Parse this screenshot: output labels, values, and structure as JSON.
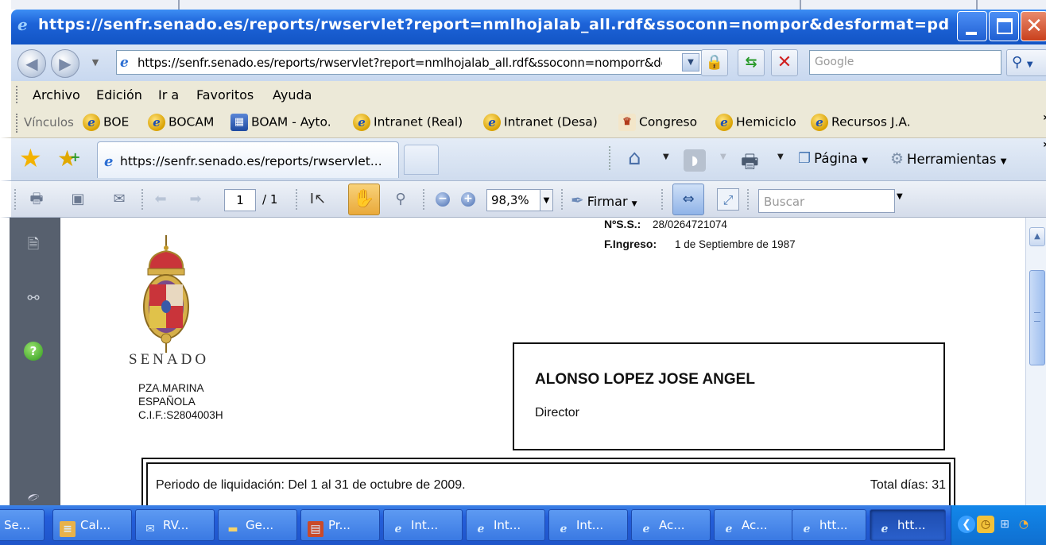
{
  "window": {
    "title": "https://senfr.senado.es/reports/rwservlet?report=nmlhojalab_all.rdf&ssoconn=nompor&desformat=pd - Windows..."
  },
  "address_bar": {
    "url": "https://senfr.senado.es/reports/rwservlet?report=nmlhojalab_all.rdf&ssoconn=nomporr&desformat=pdf",
    "search_placeholder": "Google"
  },
  "menu": {
    "items": [
      "Archivo",
      "Edición",
      "Ir a",
      "Favoritos",
      "Ayuda"
    ]
  },
  "links": {
    "label": "Vínculos",
    "items": [
      "BOE",
      "BOCAM",
      "BOAM - Ayto.",
      "Intranet (Real)",
      "Intranet (Desa)",
      "Congreso",
      "Hemiciclo",
      "Recursos J.A."
    ]
  },
  "tabs": {
    "active_label": "https://senfr.senado.es/reports/rwservlet...",
    "commands": {
      "page": "Página",
      "tools": "Herramientas"
    }
  },
  "pdf_toolbar": {
    "page_current": "1",
    "page_total": "/ 1",
    "zoom": "98,3%",
    "sign": "Firmar",
    "find_placeholder": "Buscar"
  },
  "document": {
    "ss_label": "NºS.S.:",
    "ss_value": "28/0264721074",
    "ingreso_label": "F.Ingreso:",
    "ingreso_value": "1 de Septiembre de 1987",
    "institution": "SENADO",
    "address_lines": [
      "PZA.MARINA",
      "ESPAÑOLA",
      "C.I.F.:S2804003H"
    ],
    "employee_name": "ALONSO LOPEZ JOSE ANGEL",
    "employee_role": "Director",
    "period": "Periodo de liquidación: Del 1 al 31 de octubre de 2009.",
    "total_days": "Total días: 31"
  },
  "taskbar": {
    "items": [
      "Se...",
      "Cal...",
      "RV...",
      "Ge...",
      "Pr...",
      "Int...",
      "Int...",
      "Int...",
      "Ac...",
      "Ac...",
      "htt...",
      "htt..."
    ],
    "active_index": 11
  },
  "colors": {
    "titlebar": "#1d63d8",
    "taskbar": "#245edb",
    "close": "#c9401c"
  },
  "icons": {
    "links": [
      "ie-icon",
      "ie-icon",
      "boam-icon",
      "ie-icon",
      "ie-icon",
      "congreso-icon",
      "ie-icon",
      "ie-icon"
    ]
  }
}
